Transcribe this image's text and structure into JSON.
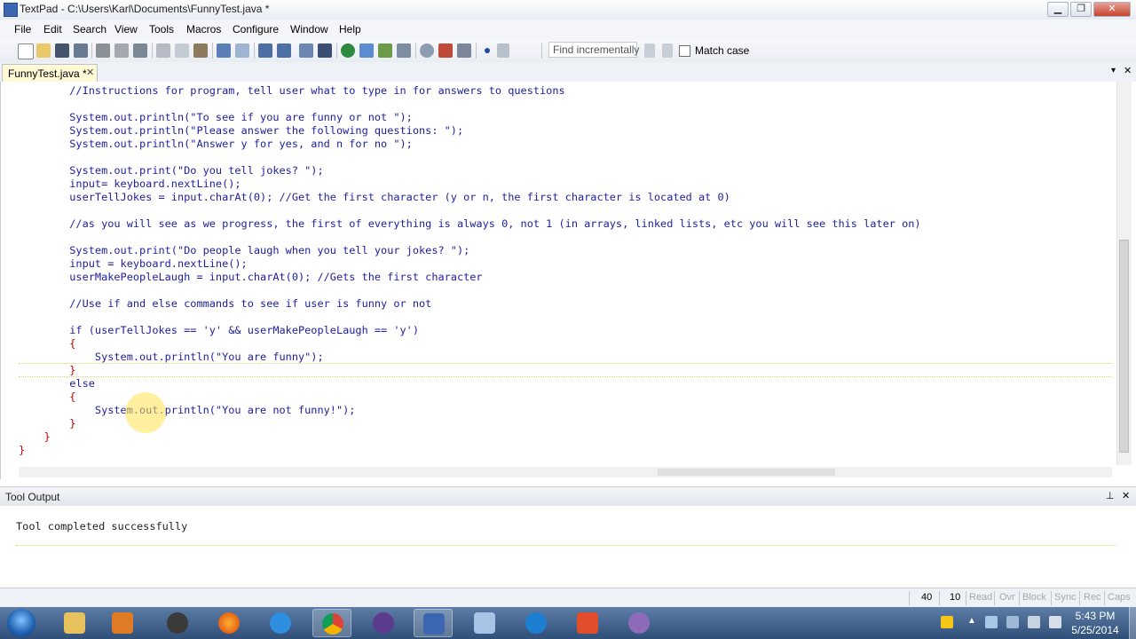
{
  "window": {
    "title": "TextPad - C:\\Users\\Karl\\Documents\\FunnyTest.java *",
    "controls": {
      "minimize": "▁",
      "maximize": "❐",
      "close": "✕"
    }
  },
  "menu": [
    "File",
    "Edit",
    "Search",
    "View",
    "Tools",
    "Macros",
    "Configure",
    "Window",
    "Help"
  ],
  "toolbar": {
    "find_placeholder": "Find incrementally",
    "match_case_label": "Match case",
    "match_case_checked": false,
    "icons": [
      "new-file-icon",
      "open-icon",
      "save-icon",
      "save-all-icon",
      "print-icon",
      "print-preview-icon",
      "spell-check-icon",
      "cut-icon",
      "copy-icon",
      "paste-icon",
      "undo-icon",
      "redo-icon",
      "indent-icon",
      "outdent-icon",
      "word-wrap-icon",
      "pilcrow-icon",
      "browser-icon",
      "compare-icon",
      "tool-icon",
      "find-icon",
      "replace-icon",
      "find-in-files-icon",
      "macro-record-icon",
      "macro-play-icon"
    ]
  },
  "tab": {
    "label": "FunnyTest.java *",
    "close": "✕"
  },
  "editor": {
    "lines": [
      {
        "text": "        //Instructions for program, tell user what to type in for answers to questions",
        "type": "code"
      },
      {
        "text": "",
        "type": "code"
      },
      {
        "text": "        System.out.println(\"To see if you are funny or not \");",
        "type": "code"
      },
      {
        "text": "        System.out.println(\"Please answer the following questions: \");",
        "type": "code"
      },
      {
        "text": "        System.out.println(\"Answer y for yes, and n for no \");",
        "type": "code"
      },
      {
        "text": "",
        "type": "code"
      },
      {
        "text": "        System.out.print(\"Do you tell jokes? \");",
        "type": "code"
      },
      {
        "text": "        input= keyboard.nextLine();",
        "type": "code"
      },
      {
        "text": "        userTellJokes = input.charAt(0); //Get the first character (y or n, the first character is located at 0)",
        "type": "code"
      },
      {
        "text": "",
        "type": "code"
      },
      {
        "text": "        //as you will see as we progress, the first of everything is always 0, not 1 (in arrays, linked lists, etc you will see this later on)",
        "type": "code"
      },
      {
        "text": "",
        "type": "code"
      },
      {
        "text": "        System.out.print(\"Do people laugh when you tell your jokes? \");",
        "type": "code"
      },
      {
        "text": "        input = keyboard.nextLine();",
        "type": "code"
      },
      {
        "text": "        userMakePeopleLaugh = input.charAt(0); //Gets the first character",
        "type": "code"
      },
      {
        "text": "",
        "type": "code"
      },
      {
        "text": "        //Use if and else commands to see if user is funny or not",
        "type": "code"
      },
      {
        "text": "",
        "type": "code"
      },
      {
        "text": "        if (userTellJokes == 'y' && userMakePeopleLaugh == 'y')",
        "type": "code"
      },
      {
        "text": "        {",
        "type": "brace"
      },
      {
        "text": "            System.out.println(\"You are funny\");",
        "type": "code"
      },
      {
        "text": "        }",
        "type": "brace"
      },
      {
        "text": "        else",
        "type": "code"
      },
      {
        "text": "        {",
        "type": "brace"
      },
      {
        "text": "            System.out.println(\"You are not funny!\");",
        "type": "code"
      },
      {
        "text": "        }",
        "type": "brace"
      },
      {
        "text": "    }",
        "type": "brace"
      },
      {
        "text": "}",
        "type": "brace"
      }
    ]
  },
  "tool_output": {
    "title": "Tool Output",
    "text": "Tool completed successfully",
    "pin": "⊥",
    "close": "✕"
  },
  "status": {
    "line": "40",
    "col": "10",
    "indicators": [
      "Read",
      "Ovr",
      "Block",
      "Sync",
      "Rec",
      "Caps"
    ]
  },
  "taskbar": {
    "start": "start-orb",
    "apps": [
      "file-explorer-icon",
      "media-player-icon",
      "hp-icon",
      "firefox-icon",
      "internet-explorer-icon",
      "chrome-icon",
      "eclipse-icon",
      "textpad-icon",
      "virtualbox-icon",
      "teamviewer-icon",
      "apps-grid-icon",
      "paint-icon"
    ],
    "time": "5:43 PM",
    "date": "5/25/2014"
  },
  "colors": {
    "code": "#1e1e9e",
    "brace": "#cc0000",
    "accent": "#3c66b0"
  }
}
